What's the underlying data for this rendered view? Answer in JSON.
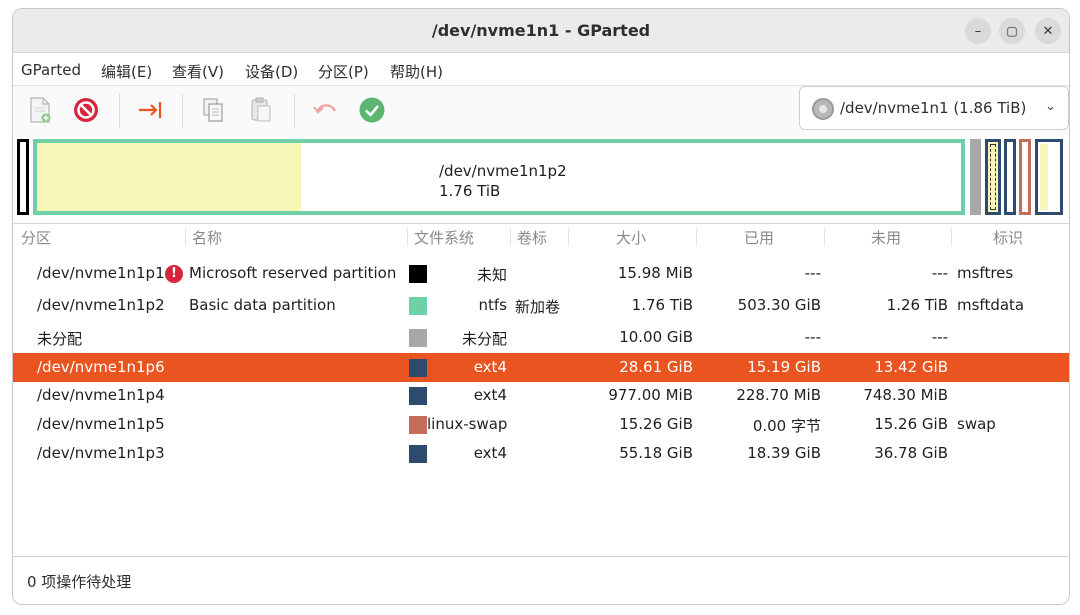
{
  "window": {
    "title": "/dev/nvme1n1 - GParted",
    "controls": {
      "minimize": "–",
      "maximize": "▢",
      "close": "✕"
    }
  },
  "menu": [
    "GParted",
    "编辑(E)",
    "查看(V)",
    "设备(D)",
    "分区(P)",
    "帮助(H)"
  ],
  "toolbar": {
    "icons": [
      "new-partition-icon",
      "delete-partition-icon",
      "resize-move-icon",
      "copy-icon",
      "paste-icon",
      "undo-icon",
      "apply-icon"
    ]
  },
  "device_selector": {
    "label": "/dev/nvme1n1 (1.86 TiB)",
    "icon": "disk-icon"
  },
  "diskmap": {
    "main_partition": {
      "name": "/dev/nvme1n1p2",
      "size": "1.76 TiB",
      "used_fraction": 0.286
    },
    "colors": {
      "ntfs": "#6fcfa7",
      "used": "#f7f7b9",
      "unallocated": "#a8a8a8",
      "ext4": "#2e4a6f",
      "swap": "#c66c5a",
      "msftres": "#000000"
    }
  },
  "table": {
    "columns": [
      "分区",
      "名称",
      "文件系统",
      "卷标",
      "大小",
      "已用",
      "未用",
      "标识"
    ],
    "rows": [
      {
        "partition": "/dev/nvme1n1p1",
        "warning": true,
        "name": "Microsoft reserved partition",
        "fs_color": "#000000",
        "filesystem": "未知",
        "label": "",
        "size": "15.98 MiB",
        "used": "---",
        "unused": "---",
        "flags": "msftres",
        "selected": false
      },
      {
        "partition": "/dev/nvme1n1p2",
        "warning": false,
        "name": "Basic data partition",
        "fs_color": "#6fcfa7",
        "filesystem": "ntfs",
        "label": "新加卷",
        "size": "1.76 TiB",
        "used": "503.30 GiB",
        "unused": "1.26 TiB",
        "flags": "msftdata",
        "selected": false
      },
      {
        "partition": "未分配",
        "warning": false,
        "name": "",
        "fs_color": "#a8a8a8",
        "filesystem": "未分配",
        "label": "",
        "size": "10.00 GiB",
        "used": "---",
        "unused": "---",
        "flags": "",
        "selected": false
      },
      {
        "partition": "/dev/nvme1n1p6",
        "warning": false,
        "name": "",
        "fs_color": "#2e4a6f",
        "filesystem": "ext4",
        "label": "",
        "size": "28.61 GiB",
        "used": "15.19 GiB",
        "unused": "13.42 GiB",
        "flags": "",
        "selected": true
      },
      {
        "partition": "/dev/nvme1n1p4",
        "warning": false,
        "name": "",
        "fs_color": "#2e4a6f",
        "filesystem": "ext4",
        "label": "",
        "size": "977.00 MiB",
        "used": "228.70 MiB",
        "unused": "748.30 MiB",
        "flags": "",
        "selected": false
      },
      {
        "partition": "/dev/nvme1n1p5",
        "warning": false,
        "name": "",
        "fs_color": "#c66c5a",
        "filesystem": "linux-swap",
        "label": "",
        "size": "15.26 GiB",
        "used": "0.00 字节",
        "unused": "15.26 GiB",
        "flags": "swap",
        "selected": false
      },
      {
        "partition": "/dev/nvme1n1p3",
        "warning": false,
        "name": "",
        "fs_color": "#2e4a6f",
        "filesystem": "ext4",
        "label": "",
        "size": "55.18 GiB",
        "used": "18.39 GiB",
        "unused": "36.78 GiB",
        "flags": "",
        "selected": false
      }
    ]
  },
  "status": {
    "text": "0 项操作待处理"
  }
}
